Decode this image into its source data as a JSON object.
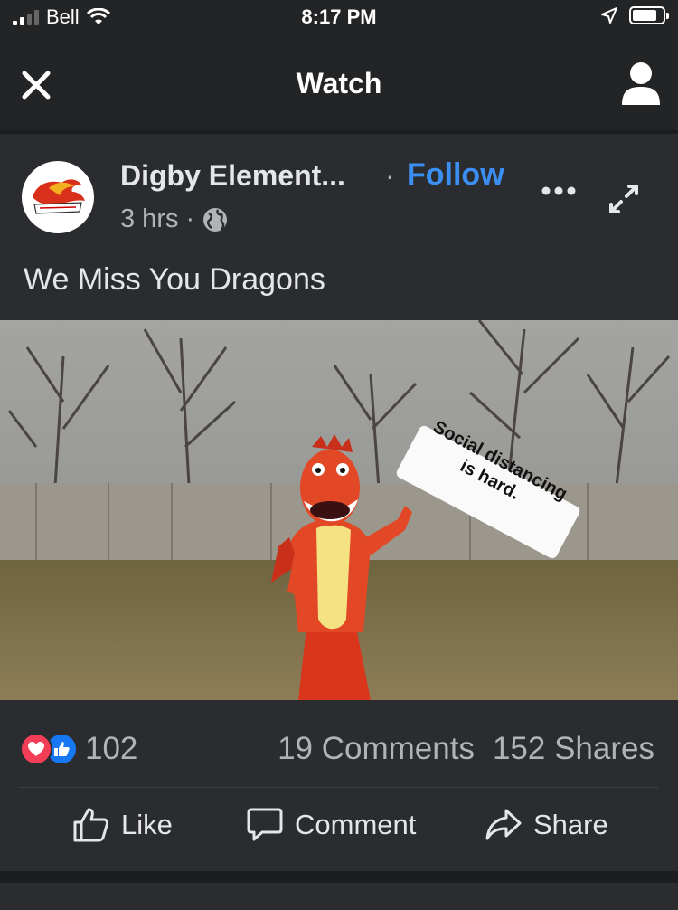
{
  "status_bar": {
    "carrier": "Bell",
    "time": "8:17 PM",
    "icons": [
      "signal-icon",
      "wifi-icon",
      "location-icon",
      "battery-icon"
    ]
  },
  "nav": {
    "title": "Watch",
    "left_icon": "close-icon",
    "right_icon": "profile-icon"
  },
  "post": {
    "page_name": "Digby Element...",
    "follow_label": "Follow",
    "time_ago": "3 hrs",
    "audience_icon": "globe-icon",
    "text": "We Miss You Dragons",
    "video": {
      "sign_line1": "Social distancing",
      "sign_line2": "is hard."
    },
    "reactions": {
      "types": [
        "love",
        "like"
      ],
      "count": "102"
    },
    "comments": "19 Comments",
    "shares": "152 Shares",
    "actions": [
      {
        "label": "Like",
        "icon": "thumbs-up-icon"
      },
      {
        "label": "Comment",
        "icon": "comment-icon"
      },
      {
        "label": "Share",
        "icon": "share-arrow-icon"
      }
    ]
  },
  "colors": {
    "background": "#1c1d1f",
    "card": "#2b2c2f",
    "bar": "#232426",
    "follow": "#3b8ff3",
    "text": "#e4e6eb",
    "muted": "#b0b3b8"
  }
}
